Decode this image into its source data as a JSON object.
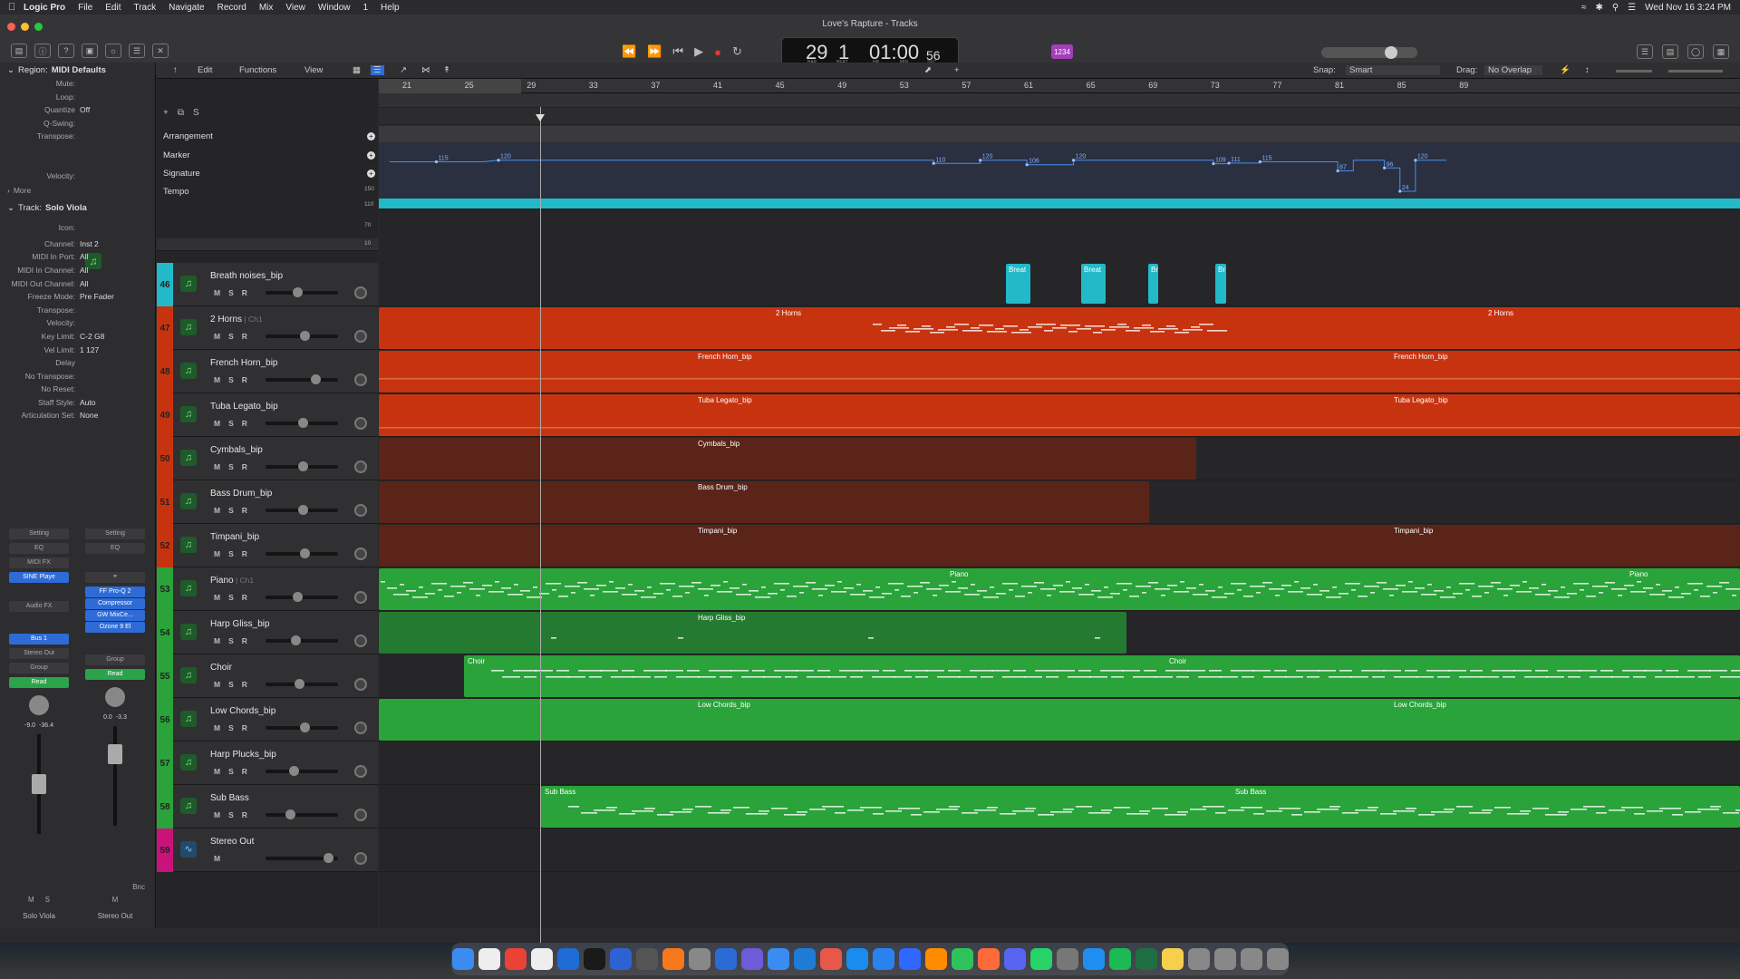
{
  "menubar": {
    "app": "Logic Pro",
    "items": [
      "File",
      "Edit",
      "Track",
      "Navigate",
      "Record",
      "Mix",
      "View",
      "Window",
      "1",
      "Help"
    ],
    "clock": "Wed Nov 16  3:24 PM"
  },
  "window": {
    "title": "Love's Rapture - Tracks"
  },
  "lcd": {
    "bar": "29",
    "beat": "1",
    "time": "01:00:56",
    "frames": "56",
    "time_main": "01:00",
    "bar_lbl": "BAR",
    "beat_lbl": "BEAT",
    "hr_lbl": "HR",
    "min_lbl": "MIN",
    "sec_lbl": "SEC"
  },
  "key_badge": "1234",
  "inspector": {
    "region_title": "Region:",
    "region_name": "MIDI Defaults",
    "region_props": [
      {
        "label": "Mute:",
        "value": ""
      },
      {
        "label": "Loop:",
        "value": ""
      },
      {
        "label": "Quantize",
        "value": "Off"
      },
      {
        "label": "Q-Swing:",
        "value": ""
      },
      {
        "label": "Transpose:",
        "value": ""
      },
      {
        "label": "",
        "value": ""
      },
      {
        "label": "",
        "value": ""
      },
      {
        "label": "Velocity:",
        "value": ""
      }
    ],
    "more": "More",
    "track_title": "Track:",
    "track_name": "Solo Viola",
    "icon_label": "Icon:",
    "track_props": [
      {
        "label": "Channel:",
        "value": "Inst 2"
      },
      {
        "label": "MIDI In Port:",
        "value": "All"
      },
      {
        "label": "MIDI In Channel:",
        "value": "All"
      },
      {
        "label": "MIDI Out Channel:",
        "value": "All"
      },
      {
        "label": "Freeze Mode:",
        "value": "Pre Fader"
      },
      {
        "label": "Transpose:",
        "value": ""
      },
      {
        "label": "Velocity:",
        "value": ""
      },
      {
        "label": "Key Limit:",
        "value": "C-2  G8"
      },
      {
        "label": "Vel Limit:",
        "value": "1  127"
      },
      {
        "label": "Delay",
        "value": ""
      },
      {
        "label": "No Transpose:",
        "value": ""
      },
      {
        "label": "No Reset:",
        "value": ""
      },
      {
        "label": "Staff Style:",
        "value": "Auto"
      },
      {
        "label": "Articulation Set:",
        "value": "None"
      }
    ],
    "strip1": {
      "setting": "Setting",
      "eq": "EQ",
      "midifx": "MIDI FX",
      "inst": "SINE Playe",
      "audiofx": "Audio FX",
      "bus": "Bus 1",
      "out": "Stereo Out",
      "group": "Group",
      "read": "Read",
      "v1": "-9.0",
      "v2": "-36.4",
      "m": "M",
      "s": "S",
      "name": "Solo Viola"
    },
    "strip2": {
      "setting": "Setting",
      "eq": "EQ",
      "fx1": "FF Pro-Q 2",
      "fx2": "Compressor",
      "fx3": "GW MixCe...",
      "fx4": "Ozone 9 El",
      "group": "Group",
      "read": "Read",
      "v1": "0.0",
      "v2": "-3.3",
      "bnc": "Bnc",
      "m": "M",
      "name": "Stereo Out"
    }
  },
  "toolbar": {
    "edit": "Edit",
    "functions": "Functions",
    "view": "View",
    "snap_lbl": "Snap:",
    "snap": "Smart",
    "drag_lbl": "Drag:",
    "drag": "No Overlap"
  },
  "global_tracks": [
    "Arrangement",
    "Marker",
    "Signature",
    "Tempo"
  ],
  "tempo_scale": [
    "150",
    "110",
    "70",
    "10"
  ],
  "ruler": [
    "21",
    "25",
    "29",
    "33",
    "37",
    "41",
    "45",
    "49",
    "53",
    "57",
    "61",
    "65",
    "69",
    "73",
    "77",
    "81",
    "85",
    "89"
  ],
  "tempo_labels": [
    {
      "t": "115"
    },
    {
      "t": "120"
    },
    {
      "t": "110"
    },
    {
      "t": "120"
    },
    {
      "t": "106"
    },
    {
      "t": "120"
    },
    {
      "t": "109"
    },
    {
      "t": "111"
    },
    {
      "t": "115"
    },
    {
      "t": "87"
    },
    {
      "t": "96"
    },
    {
      "t": "24"
    },
    {
      "t": "120"
    }
  ],
  "tracks": [
    {
      "num": "46",
      "name": "Breath noises_bip",
      "ch": "",
      "color": "#22b9c9",
      "numbg": "#22b9c9"
    },
    {
      "num": "47",
      "name": "2 Horns",
      "ch": "Ch1",
      "color": "#c8330f",
      "numbg": "#c8330f"
    },
    {
      "num": "48",
      "name": "French Horn_bip",
      "ch": "",
      "color": "#c8330f",
      "numbg": "#c8330f"
    },
    {
      "num": "49",
      "name": "Tuba Legato_bip",
      "ch": "",
      "color": "#c8330f",
      "numbg": "#c8330f"
    },
    {
      "num": "50",
      "name": "Cymbals_bip",
      "ch": "",
      "color": "#5a2418",
      "numbg": "#c8330f"
    },
    {
      "num": "51",
      "name": "Bass Drum_bip",
      "ch": "",
      "color": "#5a2418",
      "numbg": "#c8330f"
    },
    {
      "num": "52",
      "name": "Timpani_bip",
      "ch": "",
      "color": "#5a2418",
      "numbg": "#c8330f"
    },
    {
      "num": "53",
      "name": "Piano",
      "ch": "Ch1",
      "color": "#2aa33a",
      "numbg": "#2aa33a"
    },
    {
      "num": "54",
      "name": "Harp Gliss_bip",
      "ch": "",
      "color": "#237a30",
      "numbg": "#2aa33a"
    },
    {
      "num": "55",
      "name": "Choir",
      "ch": "",
      "color": "#2aa33a",
      "numbg": "#2aa33a"
    },
    {
      "num": "56",
      "name": "Low Chords_bip",
      "ch": "",
      "color": "#2aa33a",
      "numbg": "#2aa33a"
    },
    {
      "num": "57",
      "name": "Harp Plucks_bip",
      "ch": "",
      "color": "#2aa33a",
      "numbg": "#2aa33a"
    },
    {
      "num": "58",
      "name": "Sub Bass",
      "ch": "",
      "color": "#2aa33a",
      "numbg": "#2aa33a"
    },
    {
      "num": "59",
      "name": "Stereo Out",
      "ch": "",
      "color": "#c9137b",
      "numbg": "#c9137b"
    }
  ],
  "msr": {
    "m": "M",
    "s": "S",
    "r": "R"
  },
  "regions": {
    "breath": [
      "Breat",
      "Breat",
      "Br",
      "Br"
    ],
    "horns": "2 Horns",
    "french": "French Horn_bip",
    "tuba": "Tuba Legato_bip",
    "cymbals": "Cymbals_bip",
    "bassdrum": "Bass Drum_bip",
    "timpani": "Timpani_bip",
    "piano": "Piano",
    "harp": "Harp Gliss_bip",
    "choir": "Choir",
    "lowchords": "Low Chords_bip",
    "subbass": "Sub Bass"
  }
}
